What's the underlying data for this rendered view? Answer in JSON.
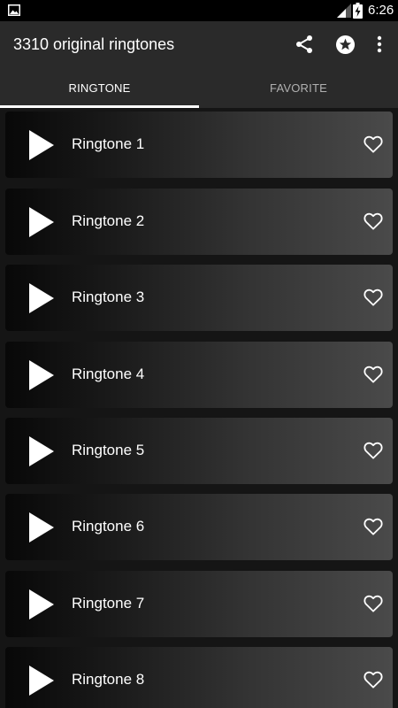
{
  "status_bar": {
    "time": "6:26",
    "icons": [
      "gallery-icon",
      "signal-icon",
      "battery-charging-icon"
    ]
  },
  "app_bar": {
    "title": "3310 original ringtones",
    "actions": [
      "share-icon",
      "star-circle-icon",
      "more-vert-icon"
    ]
  },
  "tabs": [
    {
      "label": "RINGTONE",
      "selected": true
    },
    {
      "label": "FAVORITE",
      "selected": false
    }
  ],
  "ringtones": [
    {
      "title": "Ringtone 1"
    },
    {
      "title": "Ringtone 2"
    },
    {
      "title": "Ringtone 3"
    },
    {
      "title": "Ringtone 4"
    },
    {
      "title": "Ringtone 5"
    },
    {
      "title": "Ringtone 6"
    },
    {
      "title": "Ringtone 7"
    },
    {
      "title": "Ringtone 8"
    }
  ],
  "colors": {
    "status_bar": "#000000",
    "app_bar": "#2a2a2a",
    "background": "#151515",
    "text": "#ffffff",
    "tab_inactive": "#b0b0b0"
  }
}
